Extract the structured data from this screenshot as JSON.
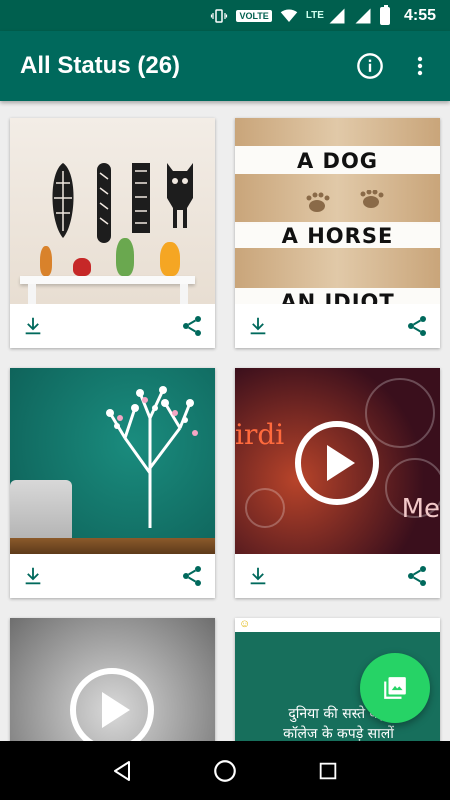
{
  "status_bar": {
    "volte": "VOLTE",
    "lte": "LTE",
    "time": "4:55"
  },
  "app_bar": {
    "title": "All Status (26)"
  },
  "cards": [
    {
      "type": "image"
    },
    {
      "type": "image",
      "lines": [
        "A DOG",
        "A HORSE",
        "AN IDIOT"
      ]
    },
    {
      "type": "image"
    },
    {
      "type": "video",
      "text_left": "irdi",
      "text_right": "Me"
    },
    {
      "type": "video"
    },
    {
      "type": "image",
      "text_lines": [
        "दुनिया की सस्ते बड़ी",
        "कॉलेज के कपड़े सालों"
      ]
    }
  ],
  "colors": {
    "primary": "#00695c",
    "status_bar": "#005f4e",
    "accent": "#26d366",
    "icon": "#00695c"
  }
}
